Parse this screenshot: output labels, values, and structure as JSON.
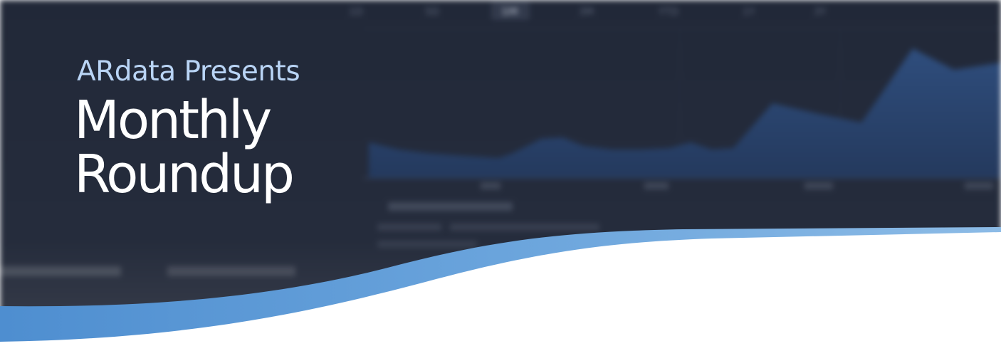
{
  "banner": {
    "eyebrow": "ARdata Presents",
    "title_line_1": "Monthly",
    "title_line_2": "Roundup"
  },
  "background_chart": {
    "range_tabs": [
      "1D",
      "5D",
      "1M",
      "3M",
      "YTD",
      "1Y",
      "3Y"
    ],
    "selected_tab": "1M"
  },
  "colors": {
    "background_dark": "#1f2535",
    "area_fill": "#2c4a77",
    "wave_light": "#86b4e2",
    "wave_mid": "#5b98d3",
    "eyebrow": "#b9d4f5",
    "title": "#ffffff"
  }
}
